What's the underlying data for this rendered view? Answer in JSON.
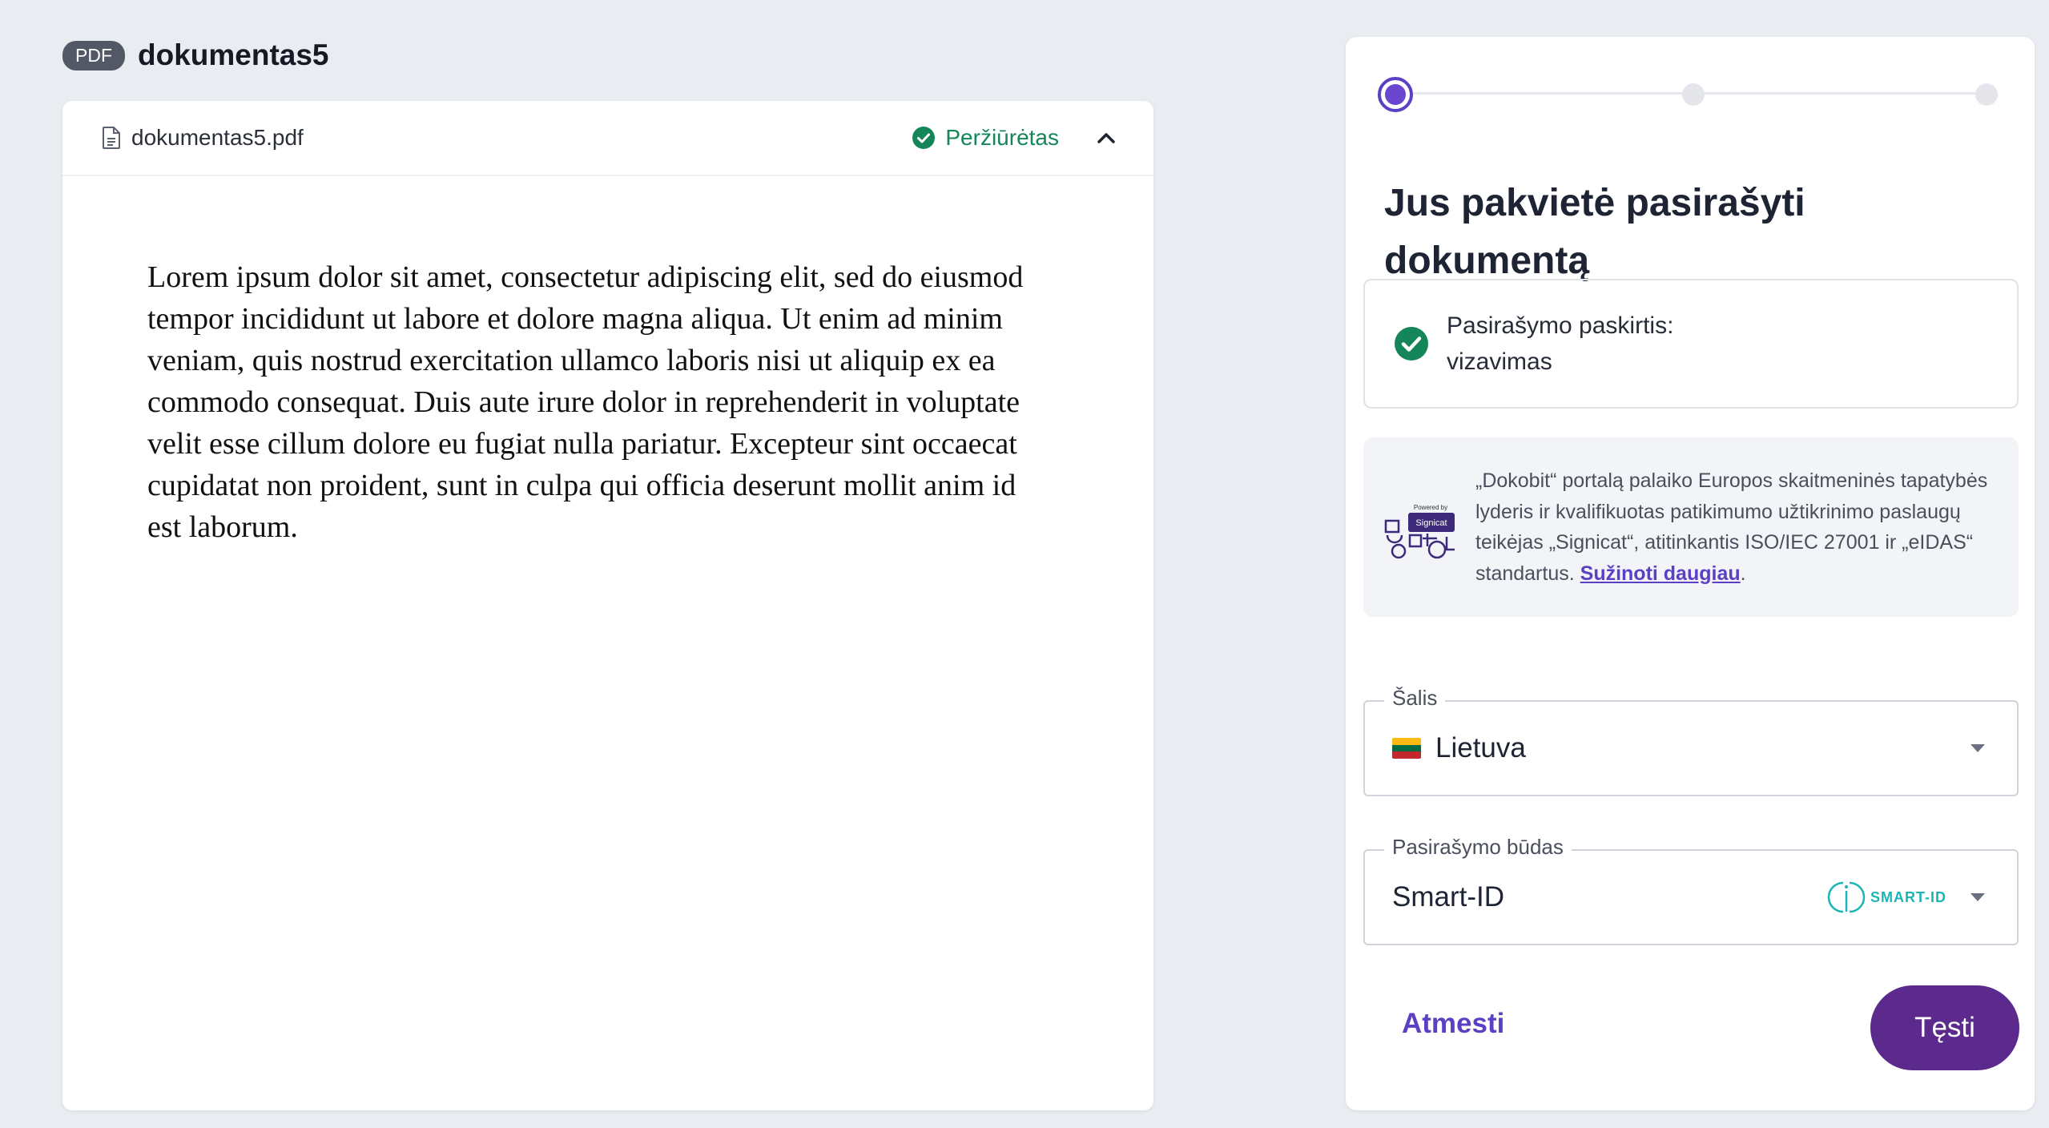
{
  "document": {
    "badge": "PDF",
    "title": "dokumentas5",
    "file_name": "dokumentas5.pdf",
    "status": "Peržiūrėtas",
    "body": "Lorem ipsum dolor sit amet, consectetur adipiscing elit, sed do eiusmod tempor incididunt ut labore et dolore magna aliqua. Ut enim ad minim veniam, quis nostrud exercitation ullamco laboris nisi ut aliquip ex ea commodo consequat. Duis aute irure dolor in reprehenderit in voluptate velit esse cillum dolore eu fugiat nulla pariatur. Excepteur sint occaecat cupidatat non proident, sunt in culpa qui officia deserunt mollit anim id est laborum."
  },
  "panel": {
    "steps_total": 3,
    "current_step": 1,
    "title": "Jus pakvietė pasirašyti dokumentą",
    "purpose_label": "Pasirašymo paskirtis:",
    "purpose_value": "vizavimas",
    "info_text": "„Dokobit“ portalą palaiko Europos skaitmeninės tapatybės lyderis ir kvalifikuotas patikimumo užtikrinimo paslaugų teikėjas „Signicat“, atitinkantis ISO/IEC 27001 ir „eIDAS“ standartus.",
    "info_link": "Sužinoti daugiau",
    "info_suffix": ".",
    "logo_caption": "Powered by",
    "logo_name": "Signicat",
    "country_label": "Šalis",
    "country_value": "Lietuva",
    "method_label": "Pasirašymo būdas",
    "method_value": "Smart-ID",
    "method_logo_text": "SMART-ID",
    "reject_label": "Atmesti",
    "continue_label": "Tęsti"
  },
  "colors": {
    "accent": "#5b3fc4",
    "primary_button": "#5b2a8c",
    "success": "#14865a",
    "smartid": "#1bb5b5"
  },
  "icons": {
    "file": "file-icon",
    "viewed": "check-circle-icon",
    "collapse": "chevron-up-icon",
    "purpose": "check-circle-icon",
    "dropdown": "caret-down-icon",
    "flag": "lithuania-flag-icon"
  }
}
